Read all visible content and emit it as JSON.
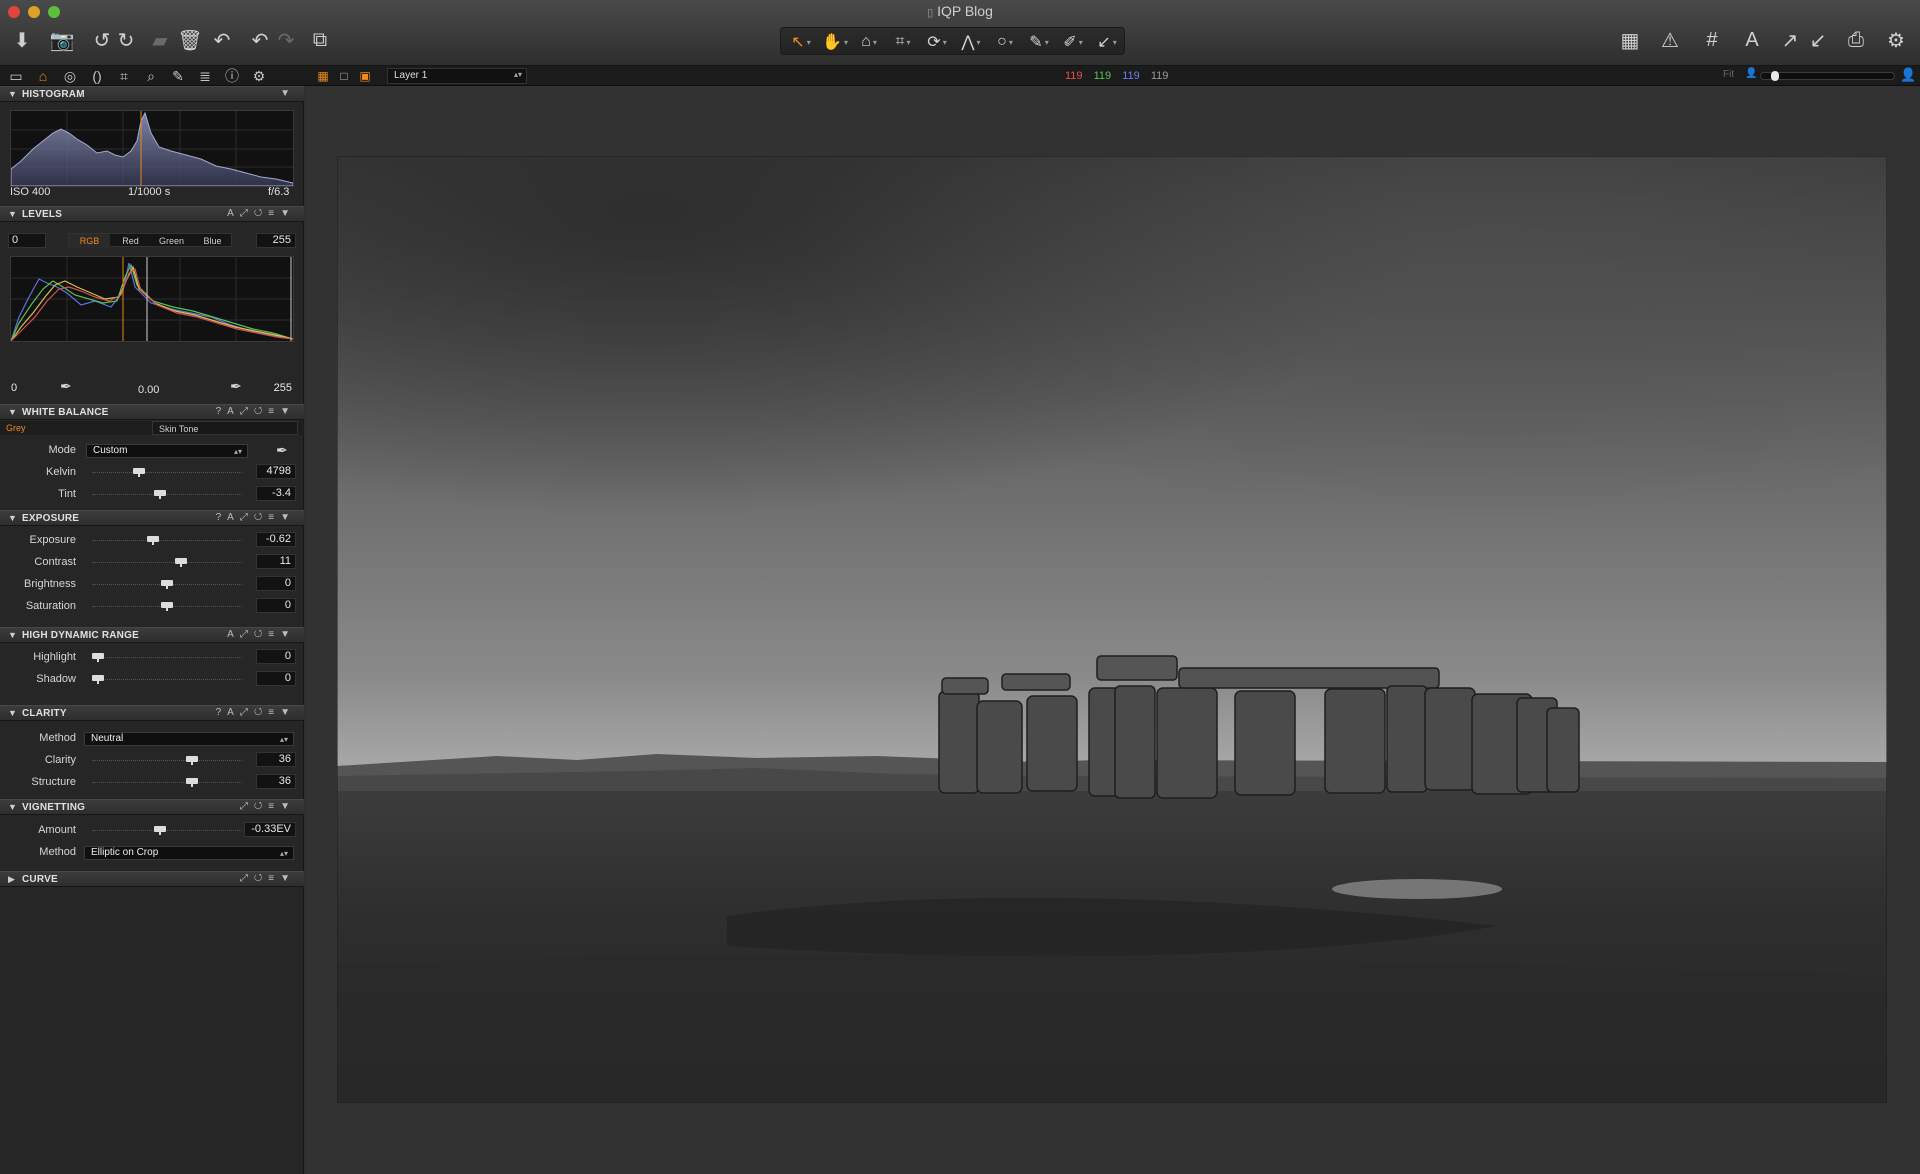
{
  "window": {
    "title": "IQP Blog",
    "traffic_colors": [
      "#e0443e",
      "#dea123",
      "#5fbf3c"
    ]
  },
  "toolbar_left": [
    {
      "name": "import-icon",
      "glyph": "⬇"
    },
    {
      "name": "camera-icon",
      "glyph": "📷"
    },
    {
      "name": "rotate-left-icon",
      "glyph": "↺"
    },
    {
      "name": "rotate-right-icon",
      "glyph": "↻"
    },
    {
      "name": "folder-icon",
      "glyph": "▰"
    },
    {
      "name": "trash-icon",
      "glyph": "🗑"
    },
    {
      "name": "reset-icon",
      "glyph": "↶"
    },
    {
      "name": "undo-icon",
      "glyph": "↶"
    },
    {
      "name": "redo-icon",
      "glyph": "↷"
    },
    {
      "name": "copy-stack-icon",
      "glyph": "⧉"
    }
  ],
  "toolbar_tools": [
    {
      "name": "cursor-tool-icon",
      "glyph": "↖"
    },
    {
      "name": "hand-tool-icon",
      "glyph": "✋"
    },
    {
      "name": "loupe-tool-icon",
      "glyph": "⌂"
    },
    {
      "name": "crop-tool-icon",
      "glyph": "⌗"
    },
    {
      "name": "rotate-tool-icon",
      "glyph": "⟳"
    },
    {
      "name": "keystone-tool-icon",
      "glyph": "⋀"
    },
    {
      "name": "spot-tool-icon",
      "glyph": "○"
    },
    {
      "name": "brush-tool-icon",
      "glyph": "✎"
    },
    {
      "name": "eraser-tool-icon",
      "glyph": "✐"
    },
    {
      "name": "picker-tool-icon",
      "glyph": "↙"
    }
  ],
  "toolbar_right": [
    {
      "name": "grid-view-icon",
      "glyph": "▦"
    },
    {
      "name": "warning-icon",
      "glyph": "⚠"
    },
    {
      "name": "grid-overlay-icon",
      "glyph": "#"
    },
    {
      "name": "text-overlay-icon",
      "glyph": "A"
    },
    {
      "name": "export-icon",
      "glyph": "↗"
    },
    {
      "name": "import-arrow-icon",
      "glyph": "↙"
    },
    {
      "name": "print-icon",
      "glyph": "⎙"
    },
    {
      "name": "settings-icon",
      "glyph": "⚙"
    }
  ],
  "tool_tabs": [
    {
      "name": "tab-library-icon",
      "glyph": "▭"
    },
    {
      "name": "tab-capture-icon",
      "glyph": "⌂",
      "active": true
    },
    {
      "name": "tab-color-icon",
      "glyph": "◎"
    },
    {
      "name": "tab-lens-icon",
      "glyph": "()"
    },
    {
      "name": "tab-composition-icon",
      "glyph": "⌗"
    },
    {
      "name": "tab-focus-icon",
      "glyph": "⌕"
    },
    {
      "name": "tab-local-adjust-icon",
      "glyph": "✎"
    },
    {
      "name": "tab-metadata-icon",
      "glyph": "≣"
    },
    {
      "name": "tab-info-icon",
      "glyph": "ⓘ"
    },
    {
      "name": "tab-settings-icon",
      "glyph": "⚙"
    }
  ],
  "view": {
    "layer": "Layer 1",
    "rgb": {
      "r": "119",
      "g": "119",
      "b": "119",
      "l": "119"
    },
    "rgb_colors": {
      "r": "#e05050",
      "g": "#56c456",
      "b": "#6a7ef0",
      "l": "#9a9a9a"
    },
    "fit_label": "Fit",
    "zoom_level": 0.08
  },
  "histogram": {
    "title": "HISTOGRAM",
    "iso": "ISO 400",
    "shutter": "1/1000 s",
    "aperture": "f/6.3"
  },
  "levels": {
    "title": "LEVELS",
    "channels": [
      "RGB",
      "Red",
      "Green",
      "Blue"
    ],
    "active_channel": "RGB",
    "in_low": "0",
    "in_high": "255",
    "out_low": "0",
    "mid": "0.00",
    "out_high": "255"
  },
  "white_balance": {
    "title": "WHITE BALANCE",
    "tabs": [
      "Grey",
      "Skin Tone"
    ],
    "mode_label": "Mode",
    "mode_value": "Custom",
    "kelvin_label": "Kelvin",
    "kelvin_value": "4798",
    "kelvin_pos": 0.3,
    "tint_label": "Tint",
    "tint_value": "-3.4",
    "tint_pos": 0.45
  },
  "exposure": {
    "title": "EXPOSURE",
    "rows": [
      {
        "label": "Exposure",
        "value": "-0.62",
        "pos": 0.4
      },
      {
        "label": "Contrast",
        "value": "11",
        "pos": 0.6
      },
      {
        "label": "Brightness",
        "value": "0",
        "pos": 0.5
      },
      {
        "label": "Saturation",
        "value": "0",
        "pos": 0.5
      }
    ]
  },
  "hdr": {
    "title": "HIGH DYNAMIC RANGE",
    "rows": [
      {
        "label": "Highlight",
        "value": "0",
        "pos": 0.0
      },
      {
        "label": "Shadow",
        "value": "0",
        "pos": 0.0
      }
    ]
  },
  "clarity": {
    "title": "CLARITY",
    "method_label": "Method",
    "method_value": "Neutral",
    "rows": [
      {
        "label": "Clarity",
        "value": "36",
        "pos": 0.68
      },
      {
        "label": "Structure",
        "value": "36",
        "pos": 0.68
      }
    ]
  },
  "vignetting": {
    "title": "VIGNETTING",
    "amount_label": "Amount",
    "amount_value": "-0.33EV",
    "amount_pos": 0.45,
    "method_label": "Method",
    "method_value": "Elliptic on Crop"
  },
  "curve": {
    "title": "CURVE"
  }
}
